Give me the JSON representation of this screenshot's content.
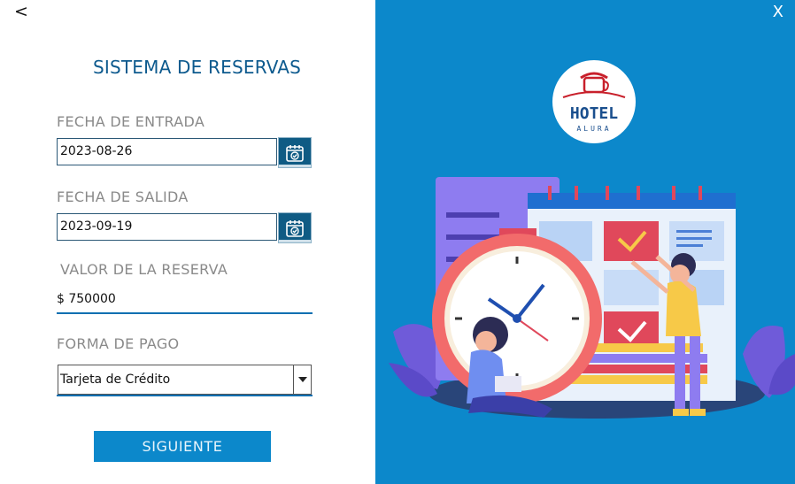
{
  "nav": {
    "back_label": "<"
  },
  "form": {
    "title": "SISTEMA DE RESERVAS",
    "check_in": {
      "label": "FECHA DE ENTRADA",
      "value": "2023-08-26"
    },
    "check_out": {
      "label": "FECHA DE SALIDA",
      "value": "2023-09-19"
    },
    "amount": {
      "label": "VALOR DE LA RESERVA",
      "value": "$ 750000"
    },
    "payment": {
      "label": "FORMA DE PAGO",
      "selected": "Tarjeta de Crédito"
    },
    "next_label": "SIGUIENTE"
  },
  "panel": {
    "close_label": "X",
    "logo_text": "HOTEL",
    "logo_subtext": "ALURA",
    "illustration": "hotel-booking-calendar-clock-illustration"
  },
  "colors": {
    "accent": "#0c88cb",
    "title": "#0d5a8e",
    "label": "#8a8a8a",
    "calendar_button": "#0f5b84",
    "logo_red": "#c8202b"
  },
  "icons": [
    "calendar-check-icon",
    "dropdown-arrow-icon",
    "hotel-logo-icon"
  ]
}
